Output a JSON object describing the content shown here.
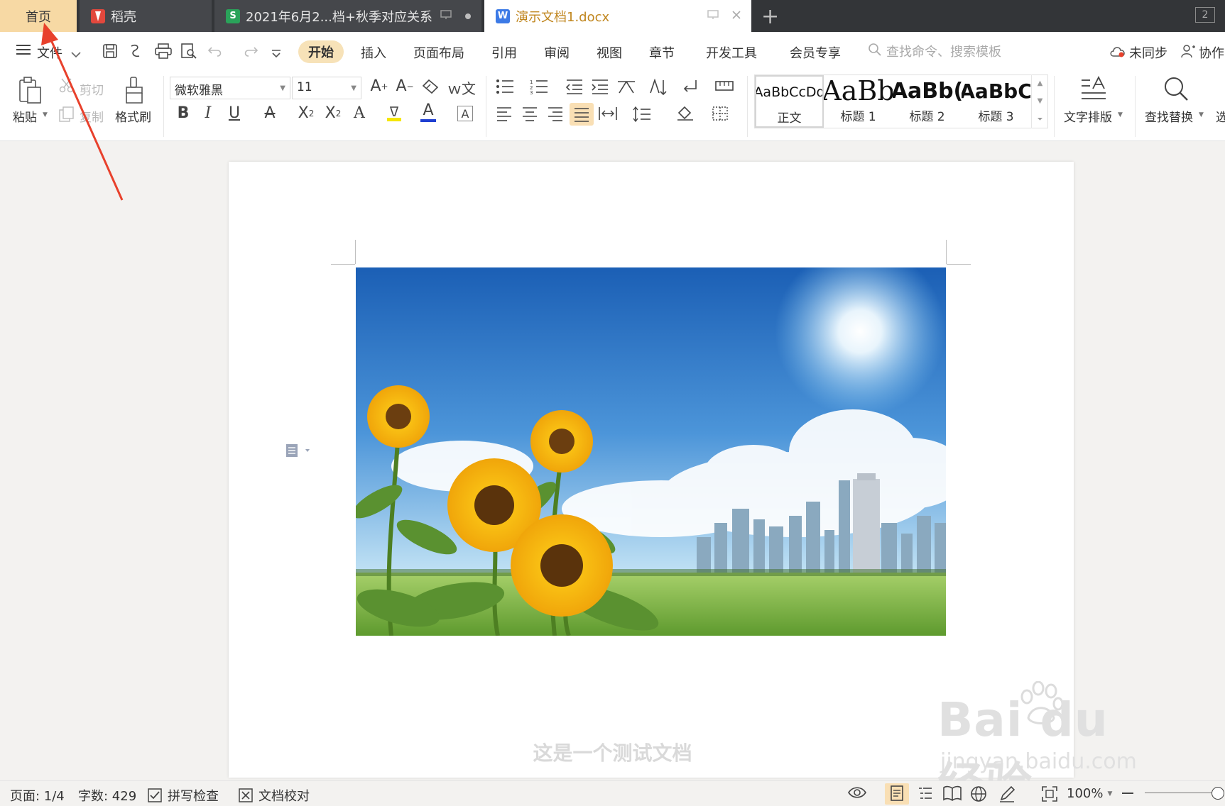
{
  "tabs": [
    {
      "label": "首页",
      "icon": "home"
    },
    {
      "label": "稻壳",
      "icon": "docer-icon",
      "icon_color": "#e2483d"
    },
    {
      "label": "2021年6月2...档+秋季对应关系",
      "icon": "spreadsheet-icon",
      "icon_color": "#2aa35a",
      "icon_glyph": "S"
    },
    {
      "label": "演示文档1.docx",
      "icon": "writer-icon",
      "icon_color": "#3c7ae6",
      "icon_glyph": "W"
    }
  ],
  "tab_count": "2",
  "menu": {
    "file": "文件",
    "start": "开始",
    "items": [
      "插入",
      "页面布局",
      "引用",
      "审阅",
      "视图",
      "章节",
      "开发工具",
      "会员专享"
    ],
    "search_placeholder": "查找命令、搜索模板",
    "sync": "未同步",
    "collab": "协作"
  },
  "ribbon": {
    "paste": "粘贴",
    "cut": "剪切",
    "copy": "复制",
    "format_painter": "格式刷",
    "font_name": "微软雅黑",
    "font_size": "11",
    "styles": [
      {
        "sample": "AaBbCcDd",
        "name": "正文"
      },
      {
        "sample": "AaBb",
        "name": "标题 1"
      },
      {
        "sample": "AaBb(",
        "name": "标题 2"
      },
      {
        "sample": "AaBbC",
        "name": "标题 3"
      }
    ],
    "text_layout": "文字排版",
    "find_replace": "查找替换",
    "select_partial": "选"
  },
  "document": {
    "body_text": "这是一个测试文档"
  },
  "watermark": {
    "big": "Bai du 经验",
    "small": "jingyan.baidu.com"
  },
  "status": {
    "page": "页面: 1/4",
    "words": "字数: 429",
    "spell_check": "拼写检查",
    "proofread": "文档校对",
    "zoom": "100%"
  },
  "colors": {
    "tabbar_bg": "#333538",
    "home_tab_bg": "#f7d9a4",
    "active_doc_tab_text": "#c0861e",
    "start_pill": "#f7e2b8",
    "annotation_arrow": "#e8412c"
  }
}
